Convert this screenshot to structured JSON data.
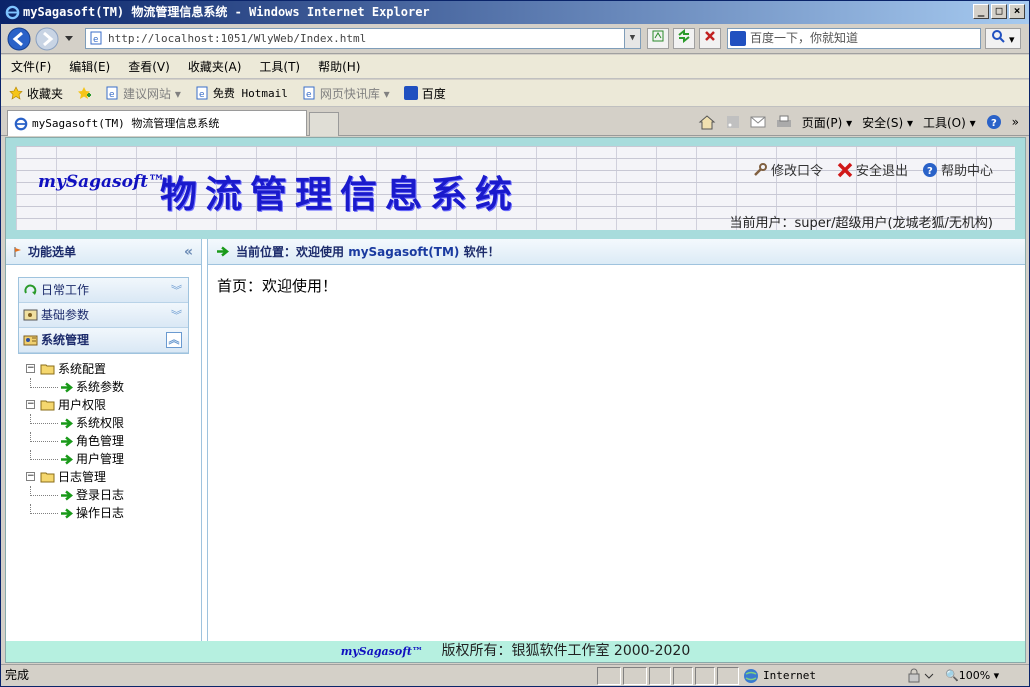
{
  "window": {
    "title": "mySagasoft(TM) 物流管理信息系统 - Windows Internet Explorer",
    "btn_min": "_",
    "btn_max": "□",
    "btn_close": "×"
  },
  "address": {
    "url": "http://localhost:1051/WlyWeb/Index.html",
    "search_placeholder": "百度一下，你就知道"
  },
  "menu": [
    "文件(F)",
    "编辑(E)",
    "查看(V)",
    "收藏夹(A)",
    "工具(T)",
    "帮助(H)"
  ],
  "favorites": {
    "label": "收藏夹",
    "items": [
      "建议网站 ▾",
      "免费 Hotmail",
      "网页快讯库 ▾",
      "百度"
    ]
  },
  "tab": {
    "title": "mySagasoft(TM) 物流管理信息系统"
  },
  "commands": {
    "page": "页面(P) ▾",
    "safety": "安全(S) ▾",
    "tools": "工具(O) ▾",
    "more": "»"
  },
  "header": {
    "logo_small": "mySagasoft™",
    "logo_big": "物流管理信息系统",
    "link_change_pwd": "修改口令",
    "link_logout": "安全退出",
    "link_help": "帮助中心",
    "current_user": "当前用户：super/超级用户(龙城老狐/无机构)"
  },
  "left_menu": {
    "title": "功能选单",
    "collapse": "«",
    "groups": [
      {
        "label": "日常工作",
        "chevron": "︾"
      },
      {
        "label": "基础参数",
        "chevron": "︾"
      },
      {
        "label": "系统管理",
        "chevron": "︽"
      }
    ],
    "tree": [
      {
        "label": "系统配置",
        "children": [
          "系统参数"
        ]
      },
      {
        "label": "用户权限",
        "children": [
          "系统权限",
          "角色管理",
          "用户管理"
        ]
      },
      {
        "label": "日志管理",
        "children": [
          "登录日志",
          "操作日志"
        ]
      }
    ]
  },
  "content": {
    "location_prefix": "当前位置：欢迎使用 ",
    "location_brand": "mySagasoft(TM)",
    "location_suffix": " 软件！",
    "welcome": "首页：欢迎使用！"
  },
  "footer": {
    "logo": "mySagasoft™",
    "copyright": "版权所有：银狐软件工作室 2000-2020"
  },
  "status": {
    "text": "完成",
    "zone": "Internet",
    "zoom": "100%"
  },
  "colors": {
    "header_bg": "#a8dcdc",
    "logo_blue": "#1a1acc",
    "footer_bg": "#b6f0e0",
    "panel_border": "#9fc3de"
  }
}
